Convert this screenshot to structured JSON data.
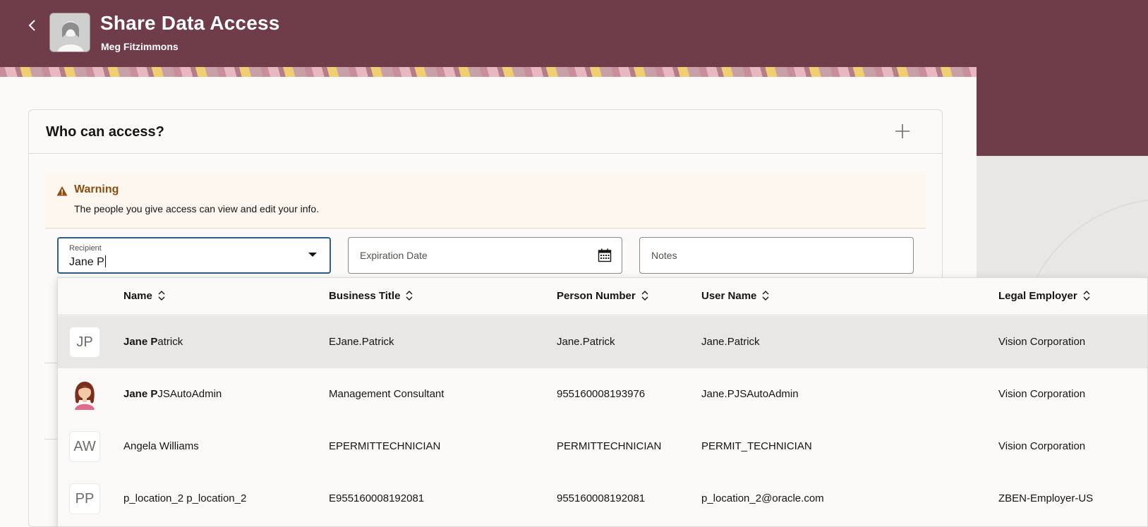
{
  "header": {
    "back_icon": "chevron-left-icon",
    "title": "Share Data Access",
    "subtitle": "Meg Fitzimmons",
    "color": "#6f3d4a"
  },
  "section": {
    "title": "Who can access?",
    "add_icon": "plus-icon"
  },
  "warning": {
    "icon": "warning-triangle-icon",
    "title": "Warning",
    "text": "The people you give access can view and edit your info.",
    "title_color": "#8a4e10"
  },
  "form": {
    "recipient_label": "Recipient",
    "recipient_value": "Jane P",
    "expiration_placeholder": "Expiration Date",
    "notes_placeholder": "Notes"
  },
  "dropdown": {
    "columns": [
      "Name",
      "Business Title",
      "Person Number",
      "User Name",
      "Legal Employer"
    ],
    "rows": [
      {
        "avatar": "JP",
        "name_match": "Jane P",
        "name_rest": "atrick",
        "business_title": "EJane.Patrick",
        "person_number": "Jane.Patrick",
        "user_name": "Jane.Patrick",
        "legal_employer": "Vision Corporation"
      },
      {
        "avatar": "",
        "name_match": "Jane P",
        "name_rest": "JSAutoAdmin",
        "business_title": "Management Consultant",
        "person_number": "955160008193976",
        "user_name": "Jane.PJSAutoAdmin",
        "legal_employer": "Vision Corporation"
      },
      {
        "avatar": "AW",
        "name_match": "",
        "name_rest": "Angela Williams",
        "business_title": "EPERMITTECHNICIAN",
        "person_number": "PERMITTECHNICIAN",
        "user_name": "PERMIT_TECHNICIAN",
        "legal_employer": "Vision Corporation"
      },
      {
        "avatar": "PP",
        "name_match": "",
        "name_rest": "p_location_2 p_location_2",
        "business_title": "E955160008192081",
        "person_number": "955160008192081",
        "user_name": "p_location_2@oracle.com",
        "legal_employer": "ZBEN-Employer-US"
      }
    ]
  }
}
